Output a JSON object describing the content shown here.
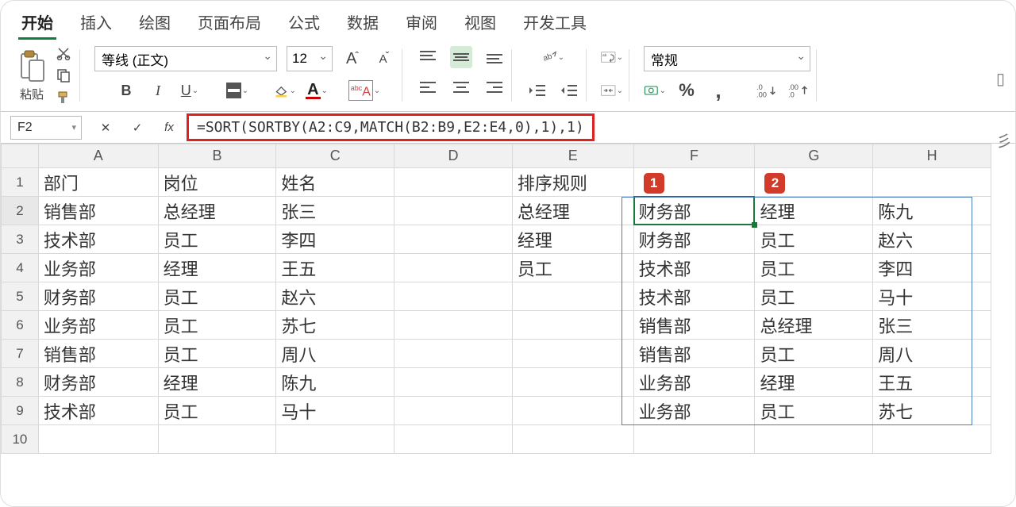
{
  "ribbon": {
    "tabs": [
      "开始",
      "插入",
      "绘图",
      "页面布局",
      "公式",
      "数据",
      "审阅",
      "视图",
      "开发工具"
    ],
    "active_tab": 0,
    "paste_label": "粘贴",
    "font_name": "等线 (正文)",
    "font_size": "12",
    "number_format": "常规"
  },
  "formulabar": {
    "namebox": "F2",
    "formula": "=SORT(SORTBY(A2:C9,MATCH(B2:B9,E2:E4,0),1),1)"
  },
  "columns": [
    "A",
    "B",
    "C",
    "D",
    "E",
    "F",
    "G",
    "H"
  ],
  "row_headers": [
    "1",
    "2",
    "3",
    "4",
    "5",
    "6",
    "7",
    "8",
    "9",
    "10"
  ],
  "badges": {
    "f1": "1",
    "g1": "2"
  },
  "cells": {
    "A1": "部门",
    "B1": "岗位",
    "C1": "姓名",
    "E1": "排序规则",
    "A2": "销售部",
    "B2": "总经理",
    "C2": "张三",
    "E2": "总经理",
    "F2": "财务部",
    "G2": "经理",
    "H2": "陈九",
    "A3": "技术部",
    "B3": "员工",
    "C3": "李四",
    "E3": "经理",
    "F3": "财务部",
    "G3": "员工",
    "H3": "赵六",
    "A4": "业务部",
    "B4": "经理",
    "C4": "王五",
    "E4": "员工",
    "F4": "技术部",
    "G4": "员工",
    "H4": "李四",
    "A5": "财务部",
    "B5": "员工",
    "C5": "赵六",
    "F5": "技术部",
    "G5": "员工",
    "H5": "马十",
    "A6": "业务部",
    "B6": "员工",
    "C6": "苏七",
    "F6": "销售部",
    "G6": "总经理",
    "H6": "张三",
    "A7": "销售部",
    "B7": "员工",
    "C7": "周八",
    "F7": "销售部",
    "G7": "员工",
    "H7": "周八",
    "A8": "财务部",
    "B8": "经理",
    "C8": "陈九",
    "F8": "业务部",
    "G8": "经理",
    "H8": "王五",
    "A9": "技术部",
    "B9": "员工",
    "C9": "马十",
    "F9": "业务部",
    "G9": "员工",
    "H9": "苏七"
  },
  "chart_data": {
    "type": "table",
    "source": {
      "columns": [
        "部门",
        "岗位",
        "姓名"
      ],
      "rows": [
        [
          "销售部",
          "总经理",
          "张三"
        ],
        [
          "技术部",
          "员工",
          "李四"
        ],
        [
          "业务部",
          "经理",
          "王五"
        ],
        [
          "财务部",
          "员工",
          "赵六"
        ],
        [
          "业务部",
          "员工",
          "苏七"
        ],
        [
          "销售部",
          "员工",
          "周八"
        ],
        [
          "财务部",
          "经理",
          "陈九"
        ],
        [
          "技术部",
          "员工",
          "马十"
        ]
      ]
    },
    "sort_rule": [
      "总经理",
      "经理",
      "员工"
    ],
    "result": {
      "rows": [
        [
          "财务部",
          "经理",
          "陈九"
        ],
        [
          "财务部",
          "员工",
          "赵六"
        ],
        [
          "技术部",
          "员工",
          "李四"
        ],
        [
          "技术部",
          "员工",
          "马十"
        ],
        [
          "销售部",
          "总经理",
          "张三"
        ],
        [
          "销售部",
          "员工",
          "周八"
        ],
        [
          "业务部",
          "经理",
          "王五"
        ],
        [
          "业务部",
          "员工",
          "苏七"
        ]
      ]
    }
  }
}
